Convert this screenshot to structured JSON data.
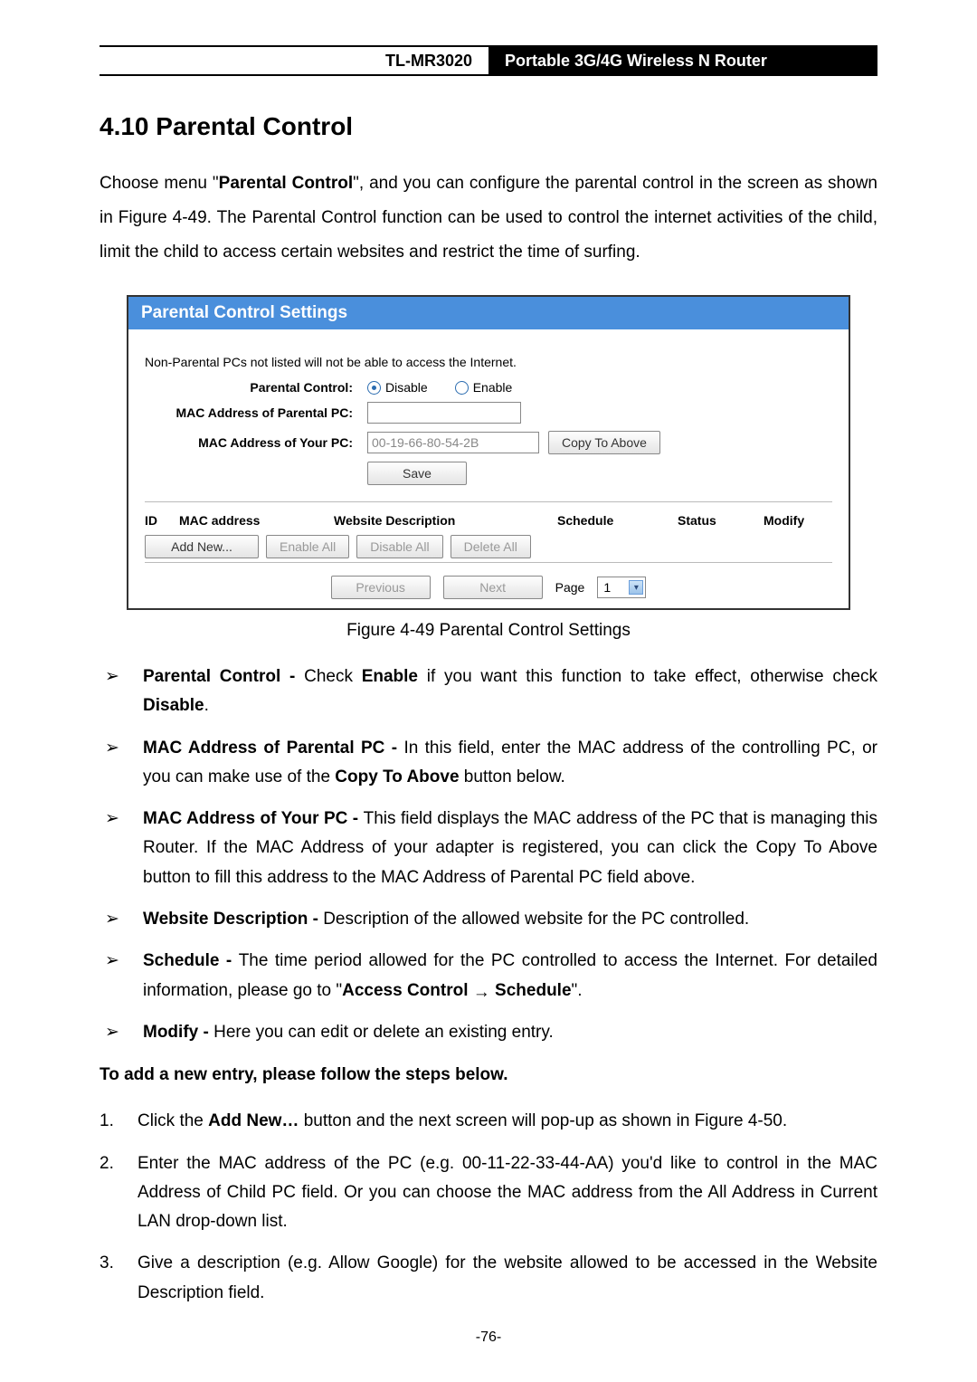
{
  "header": {
    "model": "TL-MR3020",
    "product": "Portable 3G/4G Wireless N Router"
  },
  "section_heading": "4.10 Parental Control",
  "intro_before_bold": "Choose menu \"",
  "intro_bold": "Parental Control",
  "intro_after_bold": "\", and you can configure the parental control in the screen as shown in Figure 4-49. The Parental Control function can be used to control the internet activities of the child, limit the child to access certain websites and restrict the time of surfing.",
  "panel": {
    "title": "Parental Control Settings",
    "notice": "Non-Parental PCs not listed will not be able to access the Internet.",
    "labels": {
      "pc": "Parental Control:",
      "mac_parental": "MAC Address of Parental PC:",
      "mac_your": "MAC Address of Your PC:"
    },
    "radio_disable": "Disable",
    "radio_enable": "Enable",
    "mac_parental_value": "",
    "mac_your_value": "00-19-66-80-54-2B",
    "btn_copy": "Copy To Above",
    "btn_save": "Save",
    "columns": {
      "id": "ID",
      "mac": "MAC address",
      "desc": "Website Description",
      "sched": "Schedule",
      "status": "Status",
      "modify": "Modify"
    },
    "btn_add": "Add New...",
    "btn_enable_all": "Enable All",
    "btn_disable_all": "Disable All",
    "btn_delete_all": "Delete All",
    "btn_prev": "Previous",
    "btn_next": "Next",
    "page_label": "Page",
    "page_value": "1"
  },
  "caption": "Figure 4-49    Parental Control Settings",
  "defs": [
    {
      "lead": "Parental Control - ",
      "rest_before": "Check ",
      "bold1": "Enable",
      "rest_mid": " if you want this function to take effect, otherwise check ",
      "bold2": "Disable",
      "rest_after": "."
    },
    {
      "lead": "MAC Address of Parental PC - ",
      "rest_before": "In this field, enter the MAC address of the controlling PC, or you can make use of the ",
      "bold1": "Copy To Above",
      "rest_mid": " button below.",
      "bold2": "",
      "rest_after": ""
    },
    {
      "lead": "MAC Address of Your PC - ",
      "rest_before": "This field displays the MAC address of the PC that is managing this Router. If the MAC Address of your adapter is registered, you can click the Copy To Above button to fill this address to the MAC Address of Parental PC field above.",
      "bold1": "",
      "rest_mid": "",
      "bold2": "",
      "rest_after": ""
    },
    {
      "lead": "Website Description - ",
      "rest_before": "Description of the allowed website for the PC controlled.",
      "bold1": "",
      "rest_mid": "",
      "bold2": "",
      "rest_after": ""
    },
    {
      "lead": "Schedule - ",
      "rest_before": "The time period allowed for the PC controlled to access the Internet. For detailed information, please go to \"",
      "bold1": "Access Control",
      "rest_mid": " ",
      "arrow": true,
      "bold2": "Schedule",
      "rest_after": "\"."
    },
    {
      "lead": "Modify - ",
      "rest_before": "Here you can edit or delete an existing entry.",
      "bold1": "",
      "rest_mid": "",
      "bold2": "",
      "rest_after": ""
    }
  ],
  "steps_title": "To add a new entry, please follow the steps below.",
  "steps": [
    {
      "n": "1.",
      "pre": "Click the ",
      "bold": "Add New…",
      "post": " button and the next screen will pop-up as shown in Figure 4-50."
    },
    {
      "n": "2.",
      "pre": "",
      "bold": "",
      "post": "Enter the MAC address of the PC (e.g. 00-11-22-33-44-AA) you'd like to control in the MAC Address of Child PC field. Or you can choose the MAC address from the All Address in Current LAN drop-down list."
    },
    {
      "n": "3.",
      "pre": "",
      "bold": "",
      "post": "Give a description (e.g. Allow Google) for the website allowed to be accessed in the Website Description field."
    }
  ],
  "page_number": "-76-"
}
